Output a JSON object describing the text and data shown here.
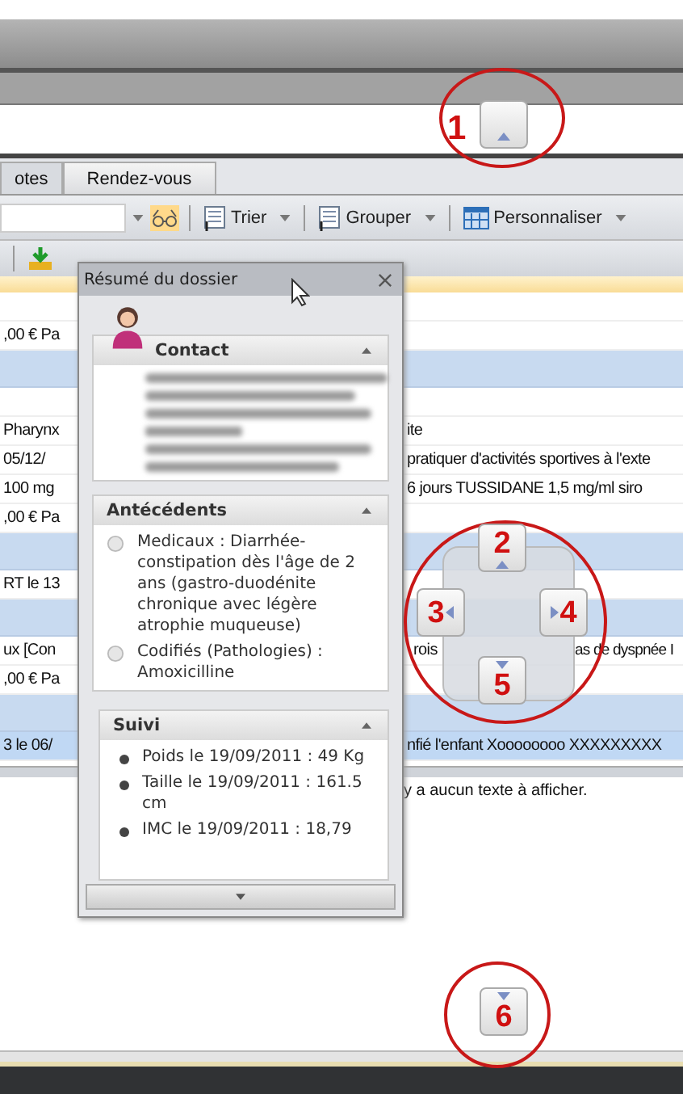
{
  "callouts": [
    "1",
    "2",
    "3",
    "4",
    "5",
    "6"
  ],
  "tabs": [
    {
      "label": "otes",
      "selected": false
    },
    {
      "label": "Rendez-vous",
      "selected": true
    }
  ],
  "toolbar": {
    "items": [
      {
        "label": "Trier",
        "kind": "sheet"
      },
      {
        "label": "Grouper",
        "kind": "sheet"
      },
      {
        "label": "Personnaliser",
        "kind": "grid"
      }
    ]
  },
  "rows": [
    {
      "kind": "blank"
    },
    {
      "kind": "line",
      "cells": [
        ",00 € Pa"
      ]
    },
    {
      "kind": "band"
    },
    {
      "kind": "blank"
    },
    {
      "kind": "line",
      "cells": [
        "Pharynx",
        "ite"
      ]
    },
    {
      "kind": "line",
      "cells": [
        "05/12/",
        "pratiquer d'activités sportives à l'exte"
      ]
    },
    {
      "kind": "line",
      "cells": [
        "100 mg",
        "6 jours  TUSSIDANE 1,5 mg/ml siro"
      ]
    },
    {
      "kind": "line",
      "cells": [
        ",00 € Pa"
      ]
    },
    {
      "kind": "band"
    },
    {
      "kind": "line",
      "cells": [
        "RT le 13"
      ]
    },
    {
      "kind": "band"
    },
    {
      "kind": "line",
      "cells": [
        "ux [Con",
        "rois",
        "as de dyspnée  I"
      ]
    },
    {
      "kind": "line",
      "cells": [
        ",00 € Pa"
      ]
    },
    {
      "kind": "band"
    },
    {
      "kind": "highlight",
      "cells": [
        "3 le 06/",
        "nfié l'enfant Xoooooooo XXXXXXXXX"
      ]
    }
  ],
  "empty_message": "y a aucun texte à afficher.",
  "popup": {
    "title": "Résumé du dossier",
    "sections": [
      {
        "title": "Contact",
        "kind": "contact"
      },
      {
        "title": "Antécédents",
        "kind": "radio",
        "items": [
          "Medicaux : Diarrhée-constipation dès l'âge de 2 ans (gastro-duodénite chronique avec légère atrophie muqueuse)",
          "Codifiés (Pathologies) : Amoxicilline"
        ]
      },
      {
        "title": "Suivi",
        "kind": "bullet",
        "items": [
          "Poids le 19/09/2011 : 49 Kg",
          "Taille le 19/09/2011 : 161.5 cm",
          "IMC le 19/09/2011 : 18,79"
        ]
      }
    ]
  }
}
